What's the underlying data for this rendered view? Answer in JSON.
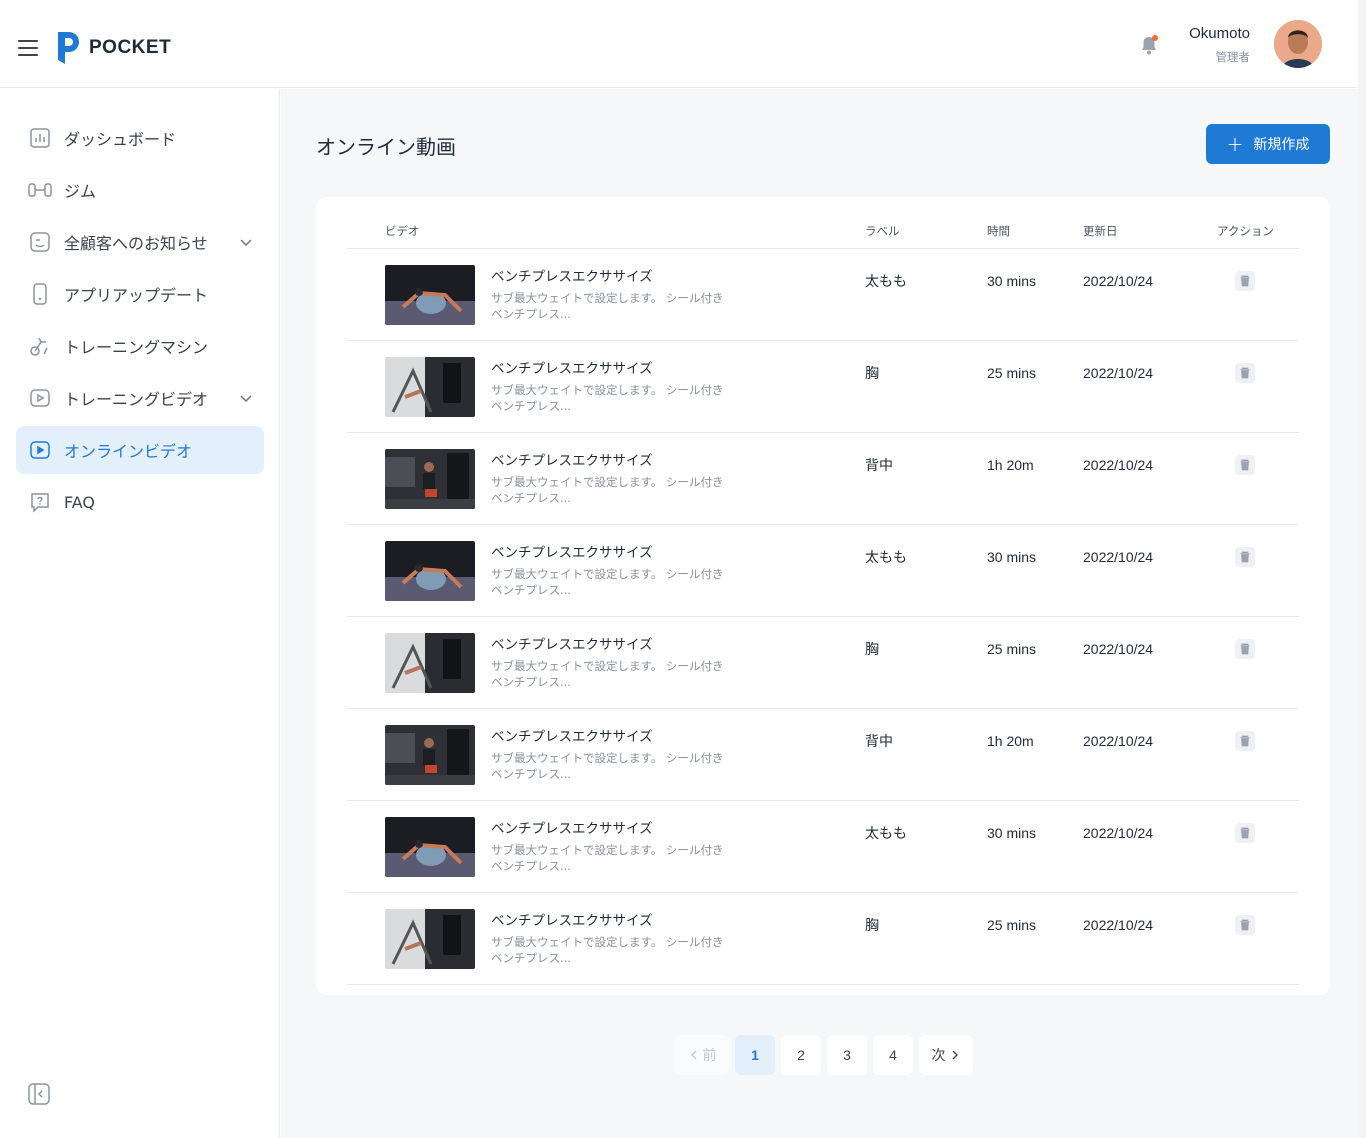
{
  "header": {
    "brand": "POCKET",
    "user_name": "Okumoto",
    "user_role": "管理者",
    "accent_color": "#1f7ad6",
    "notification_dot_color": "#f06b35"
  },
  "sidebar": {
    "items": [
      {
        "label": "ダッシュボード",
        "icon": "chart-icon"
      },
      {
        "label": "ジム",
        "icon": "dumbbell-icon"
      },
      {
        "label": "全顧客へのお知らせ",
        "icon": "notice-icon"
      },
      {
        "label": "アプリアップデート",
        "icon": "phone-icon"
      },
      {
        "label": "トレーニングマシン",
        "icon": "bike-icon"
      },
      {
        "label": "トレーニングビデオ",
        "icon": "video-icon"
      },
      {
        "label": "オンラインビデオ",
        "icon": "video-icon"
      },
      {
        "label": "FAQ",
        "icon": "help-icon"
      }
    ],
    "active_index": 6
  },
  "main": {
    "title": "オンライン動画",
    "new_button": "新規作成",
    "columns": {
      "video": "ビデオ",
      "label": "ラベル",
      "time": "時間",
      "updated": "更新日",
      "action": "アクション"
    },
    "rows": [
      {
        "title": "ベンチプレスエクササイズ",
        "desc": "サブ最大ウェイトで設定します。 シール付きベンチプレス...",
        "label": "太もも",
        "time": "30 mins",
        "date": "2022/10/24",
        "thumb": "ball-stretch-photo"
      },
      {
        "title": "ベンチプレスエクササイズ",
        "desc": "サブ最大ウェイトで設定します。 シール付きベンチプレス...",
        "label": "胸",
        "time": "25 mins",
        "date": "2022/10/24",
        "thumb": "gym-machine-photo"
      },
      {
        "title": "ベンチプレスエクササイズ",
        "desc": "サブ最大ウェイトで設定します。 シール付きベンチプレス...",
        "label": "背中",
        "time": "1h 20m",
        "date": "2022/10/24",
        "thumb": "man-seated-photo"
      },
      {
        "title": "ベンチプレスエクササイズ",
        "desc": "サブ最大ウェイトで設定します。 シール付きベンチプレス...",
        "label": "太もも",
        "time": "30 mins",
        "date": "2022/10/24",
        "thumb": "ball-stretch-photo"
      },
      {
        "title": "ベンチプレスエクササイズ",
        "desc": "サブ最大ウェイトで設定します。 シール付きベンチプレス...",
        "label": "胸",
        "time": "25 mins",
        "date": "2022/10/24",
        "thumb": "gym-machine-photo"
      },
      {
        "title": "ベンチプレスエクササイズ",
        "desc": "サブ最大ウェイトで設定します。 シール付きベンチプレス...",
        "label": "背中",
        "time": "1h 20m",
        "date": "2022/10/24",
        "thumb": "man-seated-photo"
      },
      {
        "title": "ベンチプレスエクササイズ",
        "desc": "サブ最大ウェイトで設定します。 シール付きベンチプレス...",
        "label": "太もも",
        "time": "30 mins",
        "date": "2022/10/24",
        "thumb": "ball-stretch-photo"
      },
      {
        "title": "ベンチプレスエクササイズ",
        "desc": "サブ最大ウェイトで設定します。 シール付きベンチプレス...",
        "label": "胸",
        "time": "25 mins",
        "date": "2022/10/24",
        "thumb": "gym-machine-photo"
      }
    ]
  },
  "pagination": {
    "prev": "前",
    "next": "次",
    "pages": [
      "1",
      "2",
      "3",
      "4"
    ],
    "current": "1"
  }
}
